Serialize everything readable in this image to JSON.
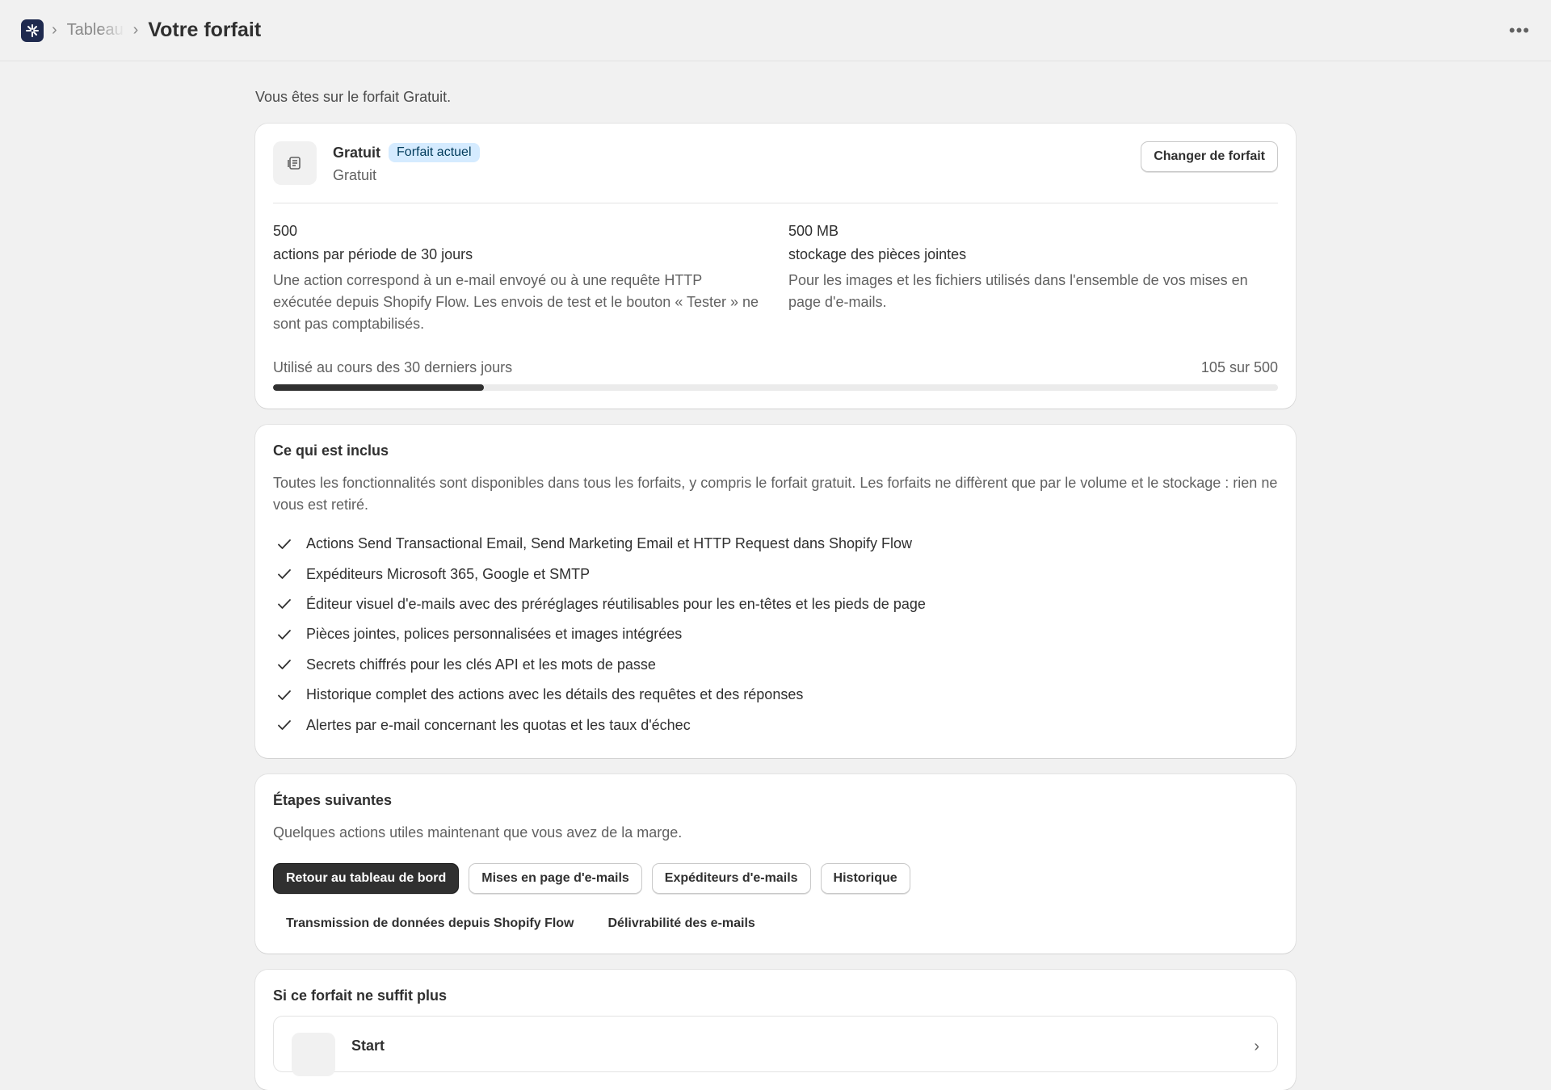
{
  "header": {
    "breadcrumb_parent": "Tableau de bord",
    "title": "Votre forfait",
    "more_label": "•••",
    "app_icon": "app-logo-icon"
  },
  "intro": "Vous êtes sur le forfait Gratuit.",
  "plan": {
    "name": "Gratuit",
    "badge": "Forfait actuel",
    "price": "Gratuit",
    "change_button": "Changer de forfait",
    "actions": {
      "value": "500",
      "label": "actions par période de 30 jours",
      "description": "Une action correspond à un e-mail envoyé ou à une requête HTTP exécutée depuis Shopify Flow. Les envois de test et le bouton « Tester » ne sont pas comptabilisés."
    },
    "storage": {
      "value": "500 MB",
      "label": "stockage des pièces jointes",
      "description": "Pour les images et les fichiers utilisés dans l'ensemble de vos mises en page d'e-mails."
    },
    "usage": {
      "label": "Utilisé au cours des 30 derniers jours",
      "value_text": "105 sur 500",
      "used": 105,
      "total": 500
    }
  },
  "included": {
    "title": "Ce qui est inclus",
    "description": "Toutes les fonctionnalités sont disponibles dans tous les forfaits, y compris le forfait gratuit. Les forfaits ne diffèrent que par le volume et le stockage : rien ne vous est retiré.",
    "features": [
      "Actions Send Transactional Email, Send Marketing Email et HTTP Request dans Shopify Flow",
      "Expéditeurs Microsoft 365, Google et SMTP",
      "Éditeur visuel d'e-mails avec des préréglages réutilisables pour les en-têtes et les pieds de page",
      "Pièces jointes, polices personnalisées et images intégrées",
      "Secrets chiffrés pour les clés API et les mots de passe",
      "Historique complet des actions avec les détails des requêtes et des réponses",
      "Alertes par e-mail concernant les quotas et les taux d'échec"
    ]
  },
  "next_steps": {
    "title": "Étapes suivantes",
    "description": "Quelques actions utiles maintenant que vous avez de la marge.",
    "buttons": {
      "dashboard": "Retour au tableau de bord",
      "layouts": "Mises en page d'e-mails",
      "senders": "Expéditeurs d'e-mails",
      "history": "Historique"
    },
    "links": {
      "flow": "Transmission de données depuis Shopify Flow",
      "deliverability": "Délivrabilité des e-mails"
    }
  },
  "upgrade": {
    "title": "Si ce forfait ne suffit plus",
    "plan_name": "Start"
  }
}
